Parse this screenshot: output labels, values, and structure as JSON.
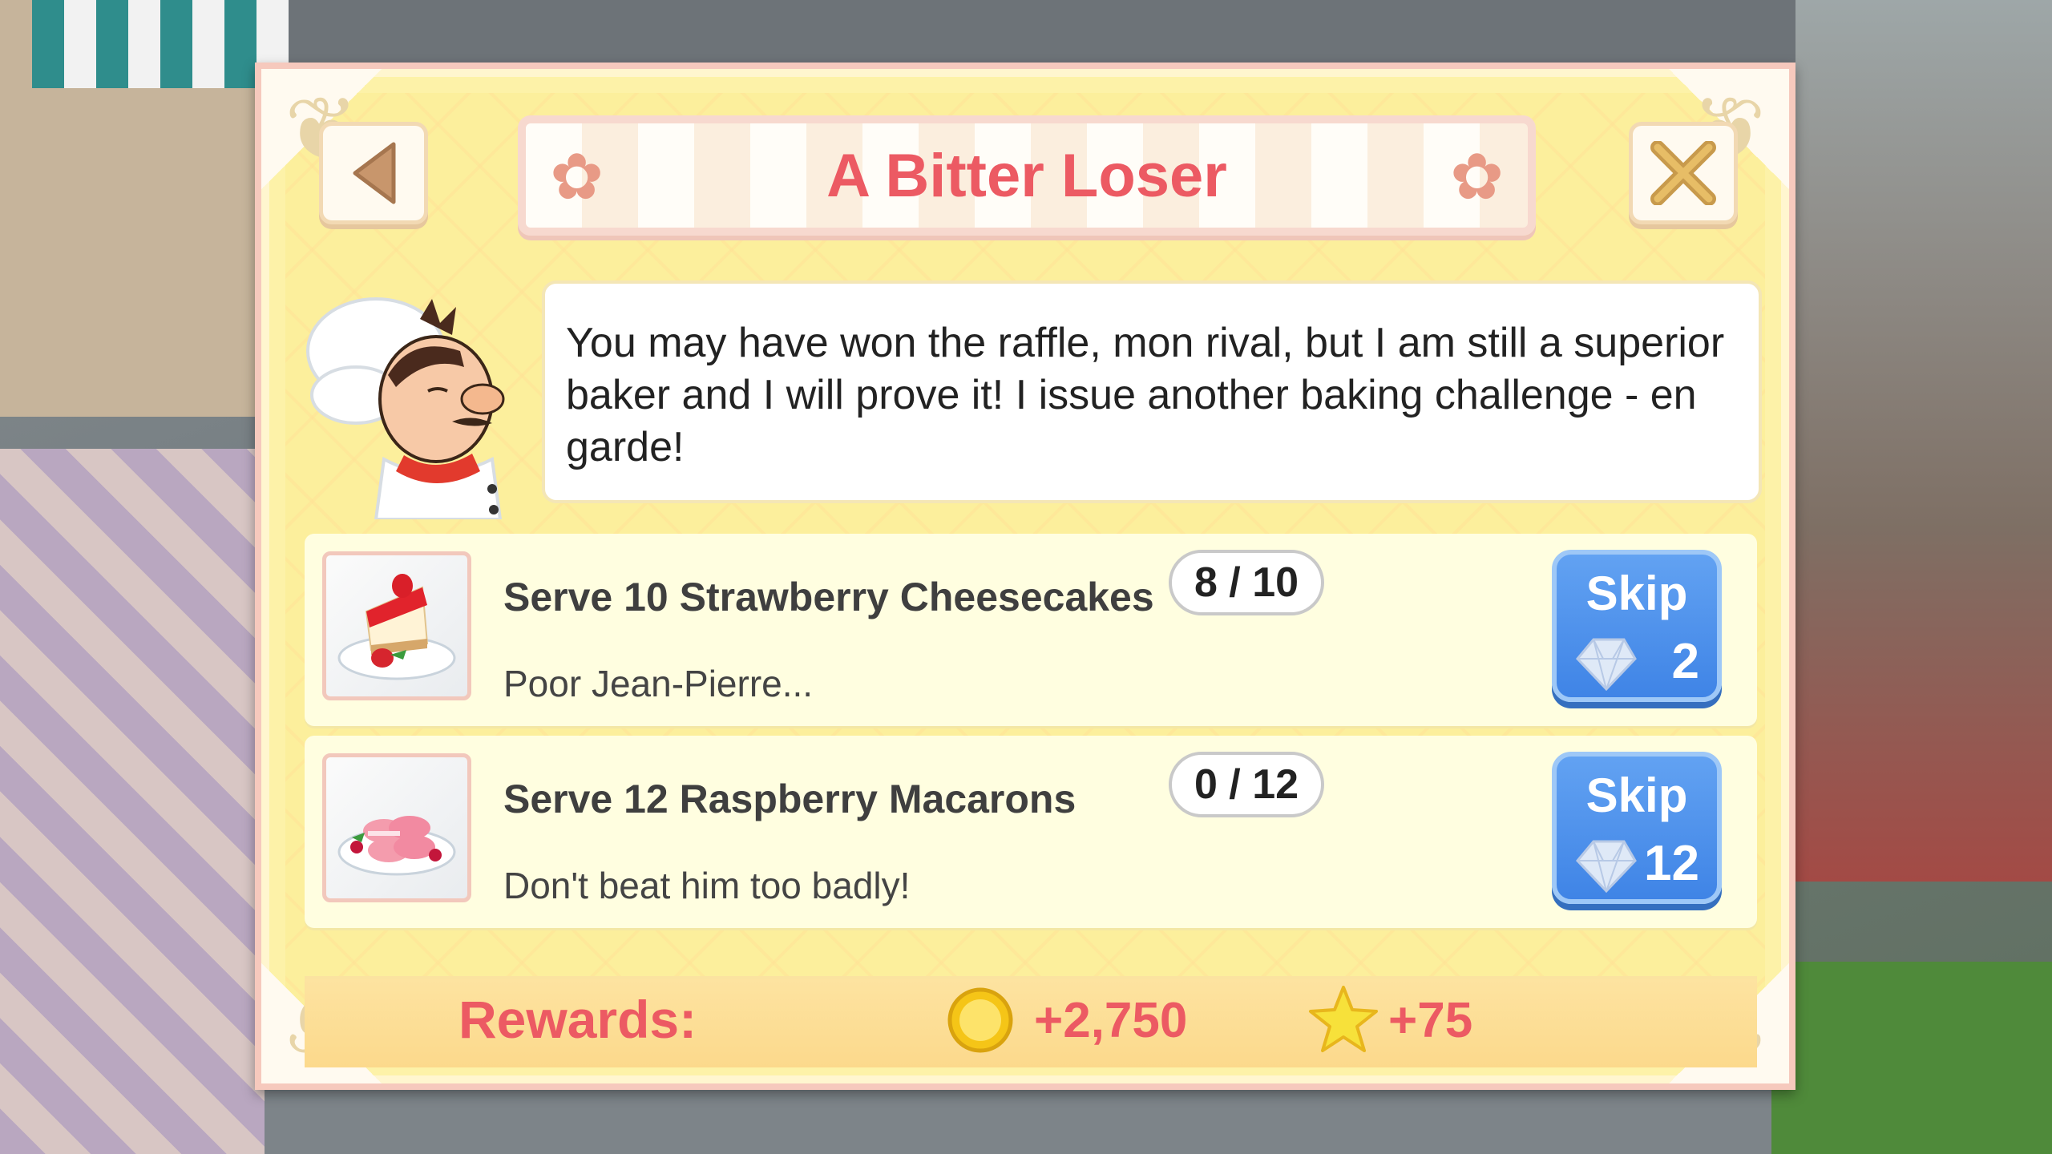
{
  "dialog": {
    "title": "A Bitter Loser",
    "message": "You may have won the raffle, mon rival, but I am still a superior baker and I will prove it! I issue another baking challenge - en garde!"
  },
  "tasks": [
    {
      "title": "Serve 10 Strawberry Cheesecakes",
      "subtitle": "Poor Jean-Pierre...",
      "progress": "8 / 10",
      "skip_label": "Skip",
      "skip_cost": "2",
      "icon": "strawberry-cheesecake"
    },
    {
      "title": "Serve 12 Raspberry Macarons",
      "subtitle": "Don't beat him too badly!",
      "progress": "0 / 12",
      "skip_label": "Skip",
      "skip_cost": "12",
      "icon": "raspberry-macarons"
    }
  ],
  "rewards": {
    "label": "Rewards:",
    "coins": "+2,750",
    "stars": "+75"
  },
  "icons": {
    "back": "back-arrow-icon",
    "close": "close-x-icon",
    "gem": "gem-icon",
    "coin": "coin-icon",
    "star": "star-icon"
  },
  "colors": {
    "title": "#ec5a63",
    "panel": "#fdf2a8",
    "skip_button": "#3f84e6",
    "frame": "#f6c9bd"
  }
}
